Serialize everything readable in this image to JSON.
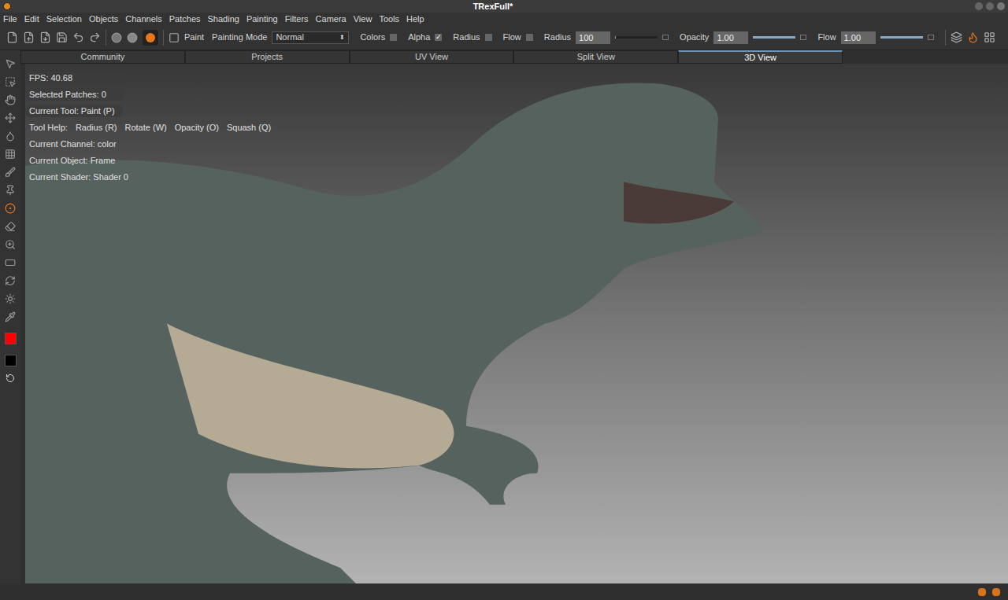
{
  "window": {
    "title": "TRexFull*"
  },
  "menu": [
    "File",
    "Edit",
    "Selection",
    "Objects",
    "Channels",
    "Patches",
    "Shading",
    "Painting",
    "Filters",
    "Camera",
    "View",
    "Tools",
    "Help"
  ],
  "toolbar": {
    "tool_label": "Paint",
    "painting_mode_label": "Painting Mode",
    "painting_mode_value": "Normal",
    "checkboxes": [
      {
        "label": "Colors",
        "checked": false
      },
      {
        "label": "Alpha",
        "checked": true
      },
      {
        "label": "Radius",
        "checked": false
      },
      {
        "label": "Flow",
        "checked": false
      }
    ],
    "fields": [
      {
        "label": "Radius",
        "value": "100",
        "level": 0.02
      },
      {
        "label": "Opacity",
        "value": "1.00",
        "level": 1
      },
      {
        "label": "Flow",
        "value": "1.00",
        "level": 1
      }
    ]
  },
  "tabs": [
    {
      "label": "Community",
      "selected": false
    },
    {
      "label": "Projects",
      "selected": false
    },
    {
      "label": "UV View",
      "selected": false
    },
    {
      "label": "Split View",
      "selected": false
    },
    {
      "label": "3D View",
      "selected": true
    }
  ],
  "viewport": {
    "info": [
      "FPS: 40.68",
      "Selected Patches: 0",
      "Current Tool: Paint (P)"
    ],
    "tool_help": {
      "label": "Tool Help:",
      "items": [
        "Radius (R)",
        "Rotate (W)",
        "Opacity (O)",
        "Squash (Q)"
      ]
    },
    "info_after": [
      "Current Channel: color",
      "Current Object: Frame",
      "Current Shader: Shader 0"
    ]
  },
  "swatches": [
    {
      "name": "foreground",
      "color": "#ff0000"
    },
    {
      "name": "background",
      "color": "#000000"
    }
  ]
}
